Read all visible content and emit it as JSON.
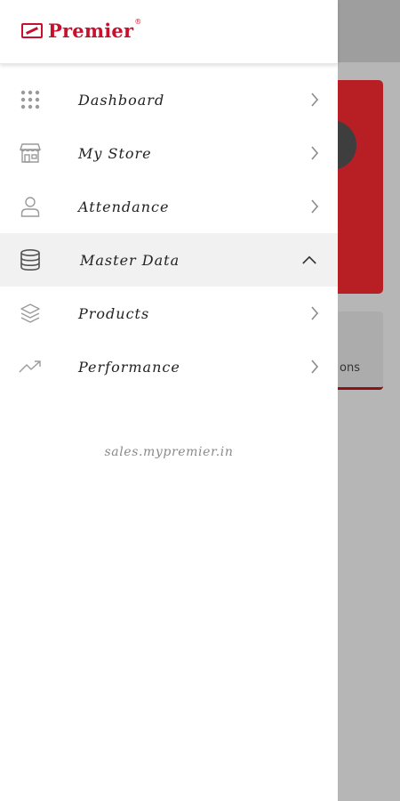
{
  "app": {
    "logo_text": "Premier",
    "logo_mark": "®",
    "brand_color": "#c8102e"
  },
  "menu": {
    "items": [
      {
        "label": "Dashboard",
        "icon": "grid-icon"
      },
      {
        "label": "My Store",
        "icon": "store-icon"
      },
      {
        "label": "Attendance",
        "icon": "person-icon"
      },
      {
        "label": "Master Data",
        "icon": "database-icon",
        "expanded": true
      },
      {
        "label": "Products",
        "icon": "layers-icon"
      },
      {
        "label": "Performance",
        "icon": "trending-up-icon"
      }
    ]
  },
  "footer": {
    "url": "sales.mypremier.in"
  },
  "background": {
    "card_text": "ons"
  }
}
